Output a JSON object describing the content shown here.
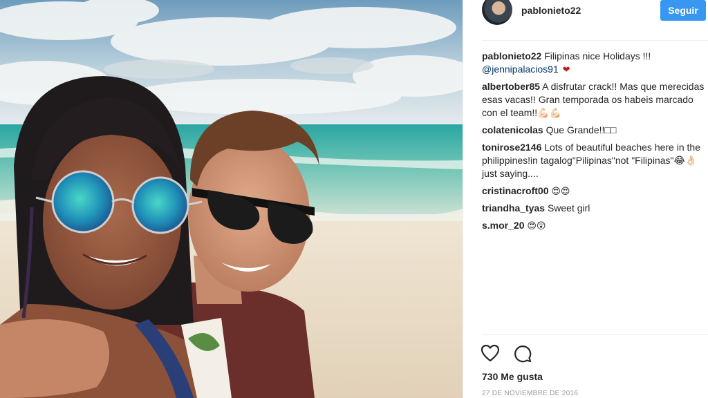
{
  "post": {
    "author": "pablonieto22",
    "follow_label": "Seguir",
    "likes": "730 Me gusta",
    "date": "27 DE NOVIEMBRE DE 2016"
  },
  "caption": {
    "user": "pablonieto22",
    "text": "Filipinas nice Holidays !!!",
    "mention": "@jennipalacios91"
  },
  "comments": [
    {
      "user": "albertober85",
      "text": "A disfrutar crack!! Mas que merecidas esas vacas!! Gran temporada os habeis marcado con el team!!💪🏻💪🏻"
    },
    {
      "user": "colatenicolas",
      "text": "Que Grande!!□□"
    },
    {
      "user": "tonirose2146",
      "text": "Lots of beautiful beaches here in the philippines!in tagalog\"Pilipinas\"not \"Filipinas\"😂👌🏻just saying...."
    },
    {
      "user": "cristinacroft00",
      "text": "😍😍"
    },
    {
      "user": "triandha_tyas",
      "text": "Sweet girl"
    },
    {
      "user": "s.mor_20",
      "text": "😍😲"
    }
  ],
  "icons": {
    "like": "heart-icon",
    "comment": "comment-icon",
    "caption_reaction": "heart-icon"
  },
  "colors": {
    "follow_button": "#3897f0",
    "mention": "#003569",
    "heart": "#b5201a"
  }
}
